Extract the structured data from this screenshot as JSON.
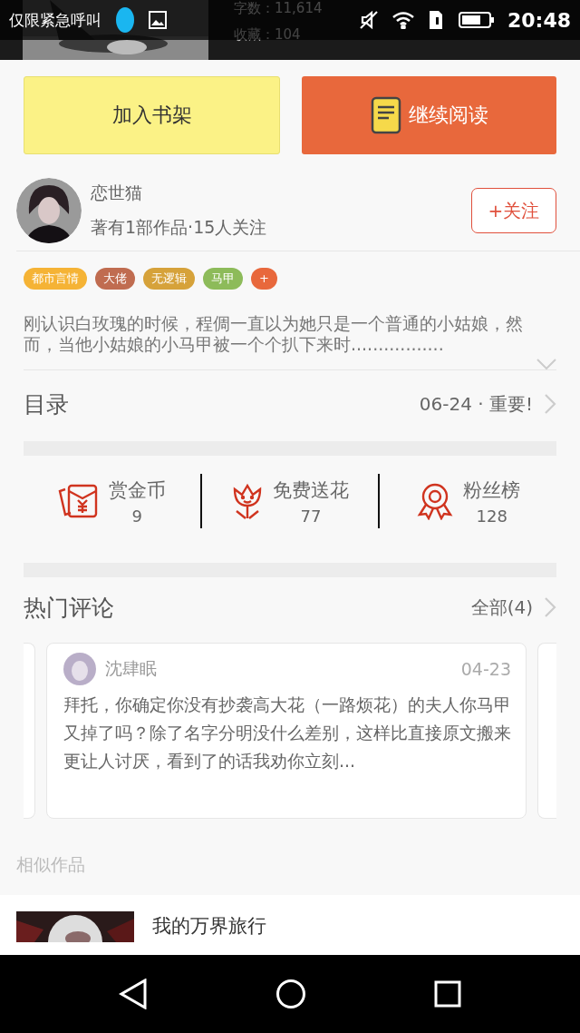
{
  "status_bar": {
    "carrier": "仅限紧急呼叫",
    "time": "20:48"
  },
  "header": {
    "stats": [
      "字数：11,614",
      "收藏：104"
    ]
  },
  "actions": [
    {
      "label": "加入书架",
      "kind": "plain"
    },
    {
      "label": "继续阅读",
      "kind": "book"
    }
  ],
  "author": {
    "name": "恋世猫",
    "info": "著有1部作品·15人关注",
    "follow": "+关注"
  },
  "tags": [
    {
      "label": "都市言情",
      "color": "#f5b335"
    },
    {
      "label": "大佬",
      "color": "#c06c50"
    },
    {
      "label": "无逻辑",
      "color": "#d6a23a"
    },
    {
      "label": "马甲",
      "color": "#8dbb5a"
    },
    {
      "label": "+",
      "color": "#e8683c"
    }
  ],
  "synopsis": "刚认识白玫瑰的时候，程倜一直以为她只是一个普通的小姑娘，然而，当他小姑娘的小马甲被一个个扒下来时.................",
  "catalog": {
    "title": "目录",
    "latest": "06-24 · 重要!"
  },
  "stats": [
    {
      "kind": "coin",
      "label": "赏金币",
      "count": "9"
    },
    {
      "kind": "flower",
      "label": "免费送花",
      "count": "77"
    },
    {
      "kind": "medal",
      "label": "粉丝榜",
      "count": "128"
    }
  ],
  "comments": {
    "title": "热门评论",
    "all": "全部(4)",
    "items": [
      {
        "user": "沈肆眠",
        "date": "04-23",
        "text": "拜托，你确定你没有抄袭高大花（一路烦花）的夫人你马甲又掉了吗？除了名字分明没什么差别，这样比直接原文搬来更让人讨厌，看到了的话我劝你立刻..."
      }
    ]
  },
  "similar": {
    "title": "相似作品",
    "books": [
      {
        "title": "我的万界旅行"
      }
    ]
  }
}
